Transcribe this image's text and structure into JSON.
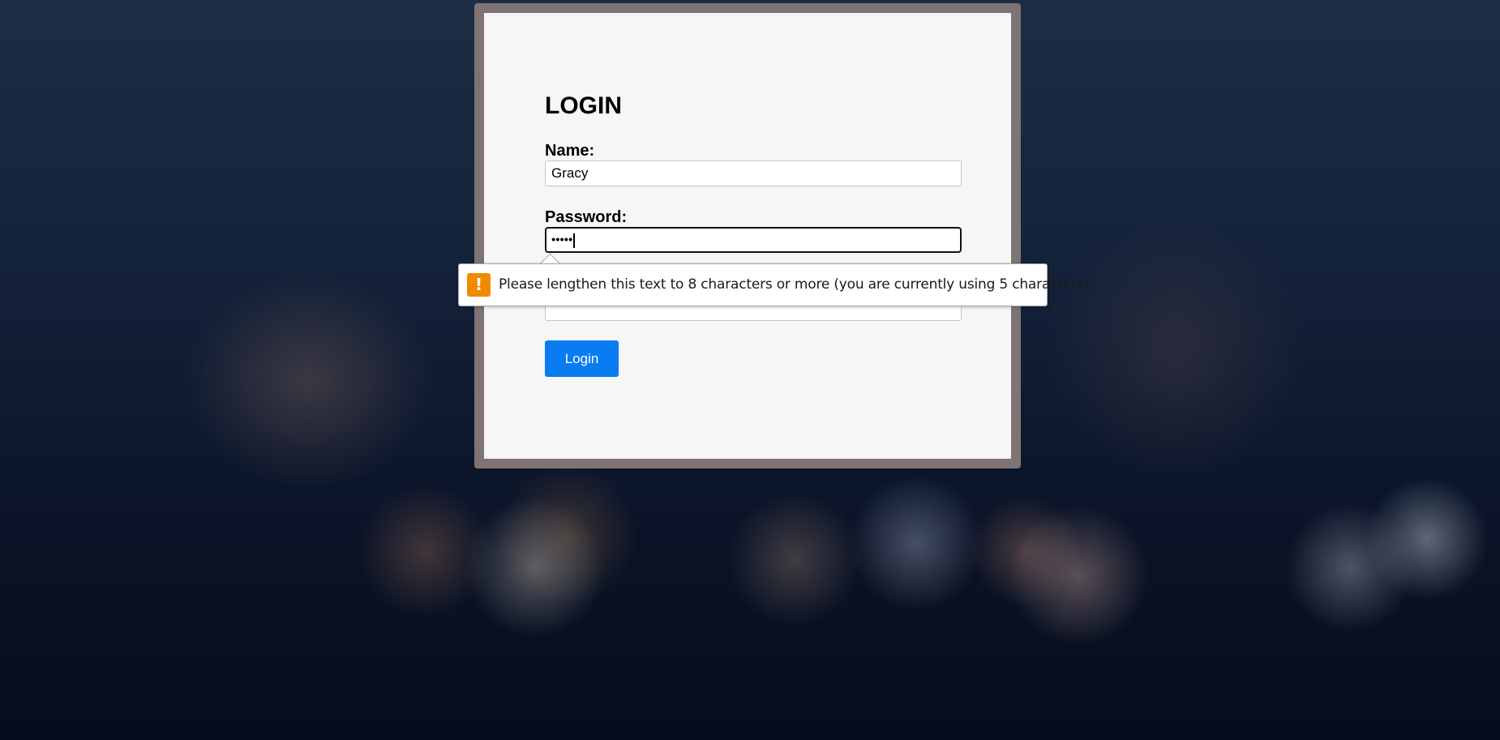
{
  "form": {
    "title": "LOGIN",
    "name_label": "Name:",
    "name_value": "Gracy",
    "password_label": "Password:",
    "password_value": "•••••",
    "login_button": "Login"
  },
  "validation": {
    "message": "Please lengthen this text to 8 characters or more (you are currently using 5 characters).",
    "icon": "!"
  },
  "colors": {
    "button": "#0a7cf2",
    "warning": "#f08a00"
  }
}
